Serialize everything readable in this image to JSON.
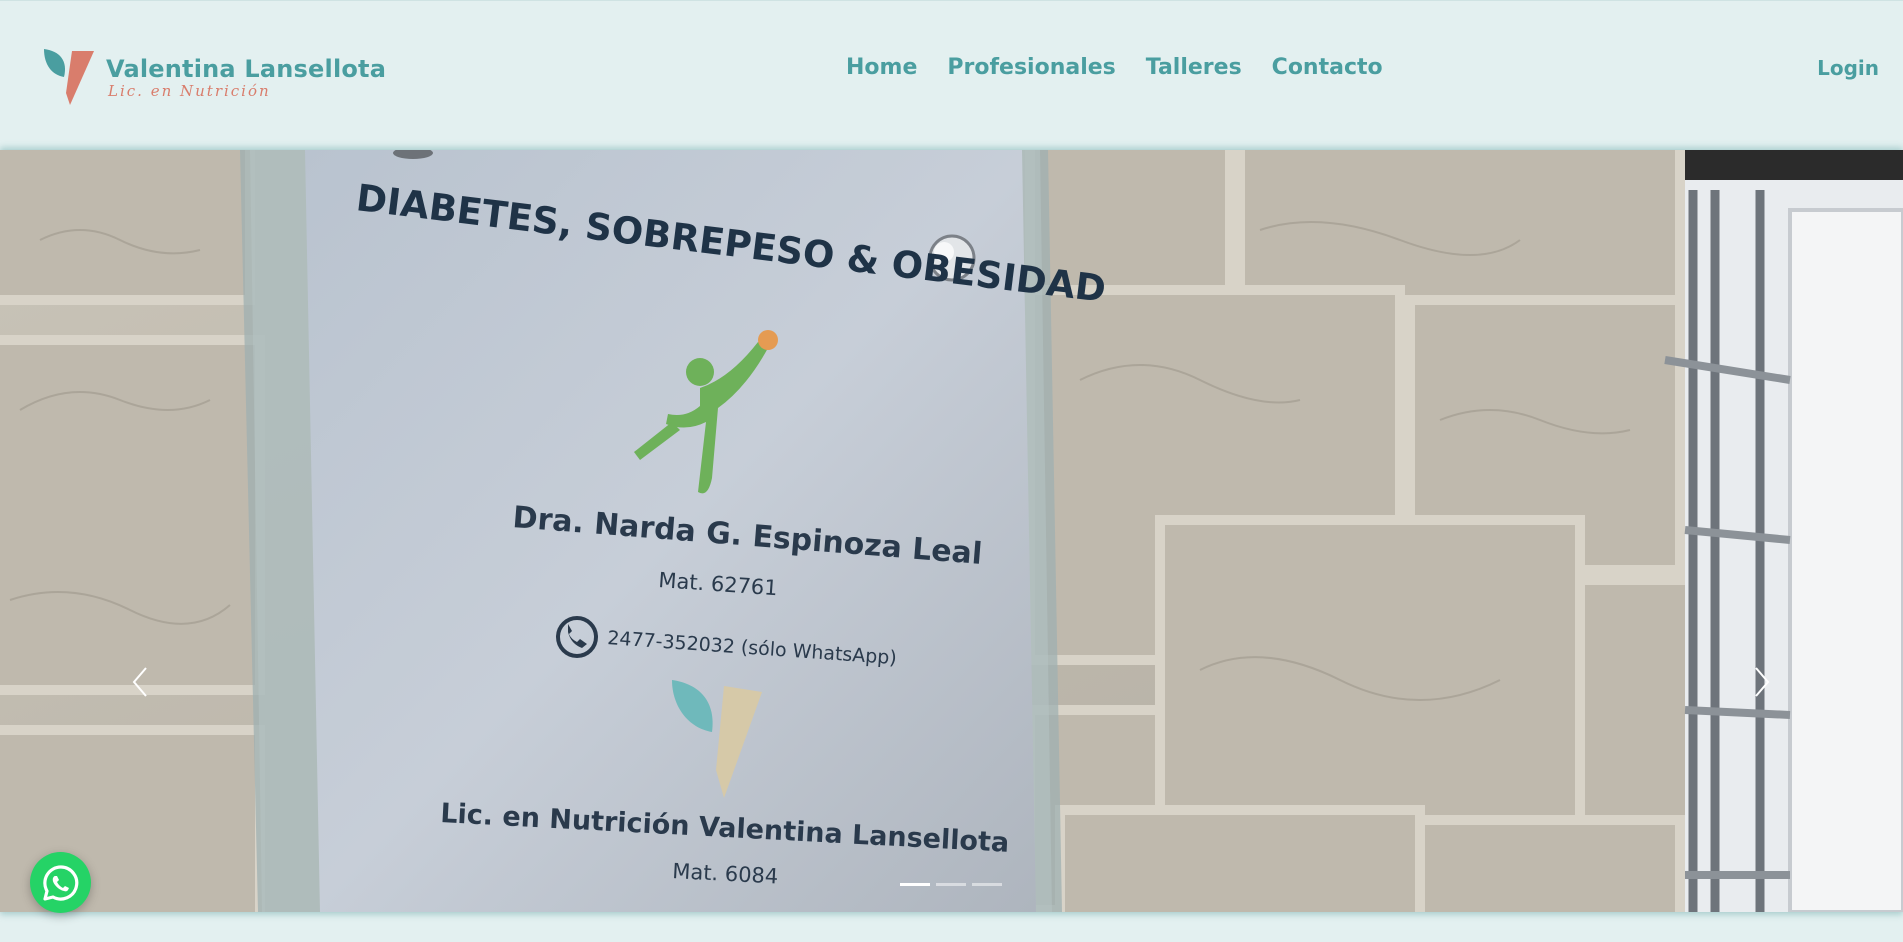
{
  "brand": {
    "name": "Valentina Lansellota",
    "subtitle": "Lic. en Nutrición"
  },
  "nav": {
    "items": [
      "Home",
      "Profesionales",
      "Talleres",
      "Contacto"
    ],
    "login": "Login"
  },
  "colors": {
    "background": "#e3f0f0",
    "accent": "#4a9ea0",
    "brand_accent": "#d97d6c",
    "whatsapp": "#25d366"
  },
  "hero": {
    "slide": {
      "heading": "DIABETES, SOBREPESO & OBESIDAD",
      "doctor_name": "Dra. Narda G. Espinoza Leal",
      "doctor_mat": "Mat. 62761",
      "phone": "2477-352032 (sólo WhatsApp)",
      "nutritionist": "Lic. en Nutrición Valentina Lansellota",
      "nutritionist_mat": "Mat. 6084"
    },
    "indicators_count": 3,
    "active_indicator": 1,
    "prev_icon": "chevron-left-icon",
    "next_icon": "chevron-right-icon"
  },
  "whatsapp": {
    "icon": "whatsapp-icon"
  }
}
